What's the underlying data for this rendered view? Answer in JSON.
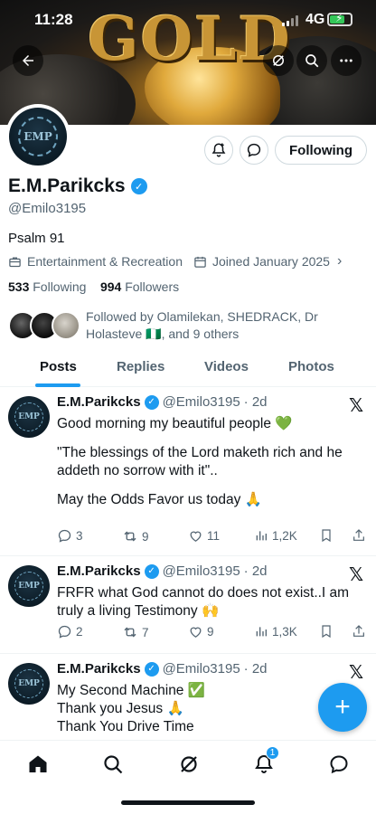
{
  "status": {
    "time": "11:28",
    "network": "4G"
  },
  "banner": {
    "text": "GOLD"
  },
  "profile": {
    "avatar_text": "EMP",
    "name": "E.M.Parikcks",
    "handle": "@Emilo3195",
    "bio": "Psalm 91",
    "category": "Entertainment & Recreation",
    "joined": "Joined January 2025",
    "following_count": "533",
    "following_label": "Following",
    "followers_count": "994",
    "followers_label": "Followers",
    "followed_by": "Followed by Olamilekan, SHEDRACK, Dr Holasteve 🇳🇬, and 9 others",
    "following_button": "Following"
  },
  "tabs": [
    "Posts",
    "Replies",
    "Videos",
    "Photos"
  ],
  "tweets": [
    {
      "name": "E.M.Parikcks",
      "handle": "@Emilo3195",
      "time": "· 2d",
      "lines": [
        "Good morning my beautiful people 💚",
        "",
        "\"The blessings of the Lord maketh rich  and he",
        "addeth no sorrow with it\"..",
        "",
        "May the Odds Favor us today 🙏"
      ],
      "replies": "3",
      "reposts": "9",
      "likes": "11",
      "views": "1,2K"
    },
    {
      "name": "E.M.Parikcks",
      "handle": "@Emilo3195",
      "time": "· 2d",
      "lines": [
        "FRFR what God cannot do does not exist..I am",
        "truly a living Testimony 🙌"
      ],
      "replies": "2",
      "reposts": "7",
      "likes": "9",
      "views": "1,3K"
    },
    {
      "name": "E.M.Parikcks",
      "handle": "@Emilo3195",
      "time": "· 2d",
      "lines": [
        "My Second Machine ✅",
        "Thank you Jesus 🙏",
        "Thank You Drive Time"
      ]
    }
  ],
  "nav": {
    "notification_count": "1"
  },
  "colors": {
    "accent": "#1d9bf0",
    "text": "#0f1419",
    "muted": "#536471"
  }
}
